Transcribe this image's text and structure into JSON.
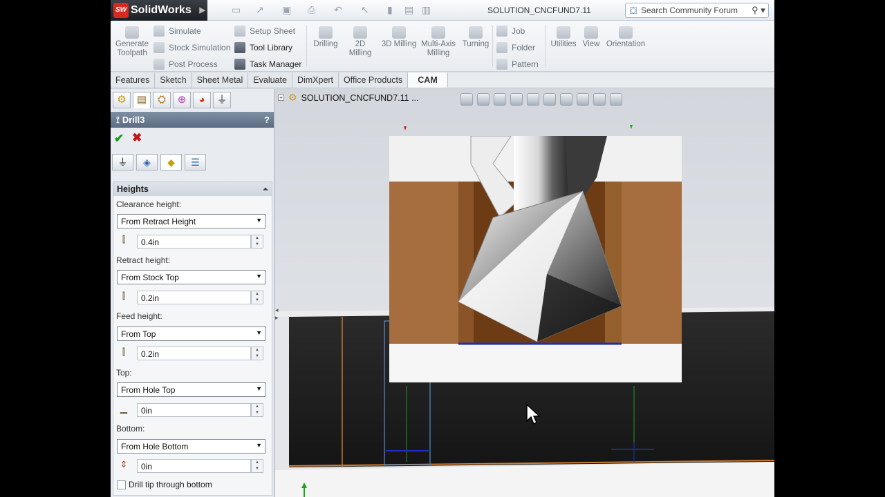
{
  "app": {
    "brand": "SolidWorks",
    "brand_badge": "SW",
    "doc_title": "SOLUTION_CNCFUND7.11",
    "search_placeholder": "Search Community Forum"
  },
  "ribbon": {
    "generate_toolpath": "Generate Toolpath",
    "simulate": "Simulate",
    "stock_simulation": "Stock Simulation",
    "post_process": "Post Process",
    "setup_sheet": "Setup Sheet",
    "tool_library": "Tool Library",
    "task_manager": "Task Manager",
    "drilling": "Drilling",
    "milling_2d": "2D Milling",
    "milling_3d": "3D Milling",
    "multi_axis": "Multi-Axis Milling",
    "turning": "Turning",
    "job": "Job",
    "folder": "Folder",
    "pattern": "Pattern",
    "utilities": "Utilities",
    "view": "View",
    "orientation": "Orientation"
  },
  "tabs": [
    "Features",
    "Sketch",
    "Sheet Metal",
    "Evaluate",
    "DimXpert",
    "Office Products",
    "CAM"
  ],
  "active_tab": "CAM",
  "property_manager": {
    "title": "Drill3",
    "help": "?",
    "group_title": "Heights",
    "fields": {
      "clearance": {
        "label": "Clearance height:",
        "mode": "From Retract Height",
        "value": "0.4in"
      },
      "retract": {
        "label": "Retract height:",
        "mode": "From Stock Top",
        "value": "0.2in"
      },
      "feed": {
        "label": "Feed height:",
        "mode": "From Top",
        "value": "0.2in"
      },
      "top": {
        "label": "Top:",
        "mode": "From Hole Top",
        "value": "0in"
      },
      "bottom": {
        "label": "Bottom:",
        "mode": "From Hole Bottom",
        "value": "0in"
      }
    },
    "drill_tip_label": "Drill tip through bottom",
    "drill_tip_checked": false
  },
  "viewport": {
    "tree_root": "SOLUTION_CNCFUND7.11 ..."
  }
}
